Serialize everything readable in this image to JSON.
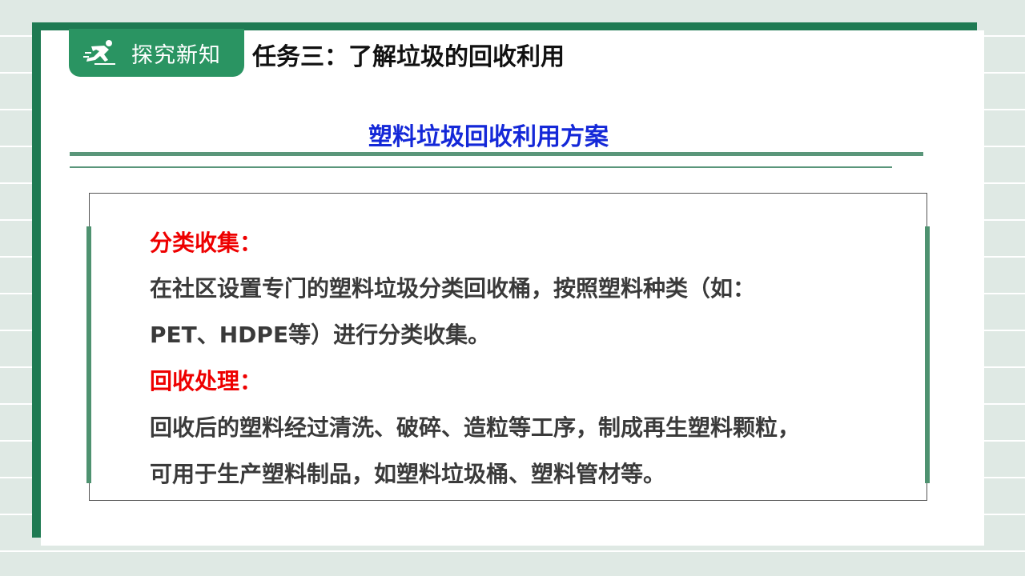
{
  "badge": {
    "label": "探究新知",
    "icon": "running-person-icon"
  },
  "task_title": "任务三：了解垃圾的回收利用",
  "section_title": "塑料垃圾回收利用方案",
  "content": {
    "heading1": "分类收集：",
    "para1_line1": "在社区设置专门的塑料垃圾分类回收桶，按照塑料种类（如：",
    "para1_line2": "PET、HDPE等）进行分类收集。",
    "heading2": "回收处理：",
    "para2_line1": "回收后的塑料经过清洗、破碎、造粒等工序，制成再生塑料颗粒，",
    "para2_line2": "可用于生产塑料制品，如塑料垃圾桶、塑料管材等。"
  },
  "colors": {
    "brand_green": "#2a9462",
    "frame_green": "#1e7a52",
    "title_blue": "#1428d8",
    "heading_red": "#ee0000"
  }
}
